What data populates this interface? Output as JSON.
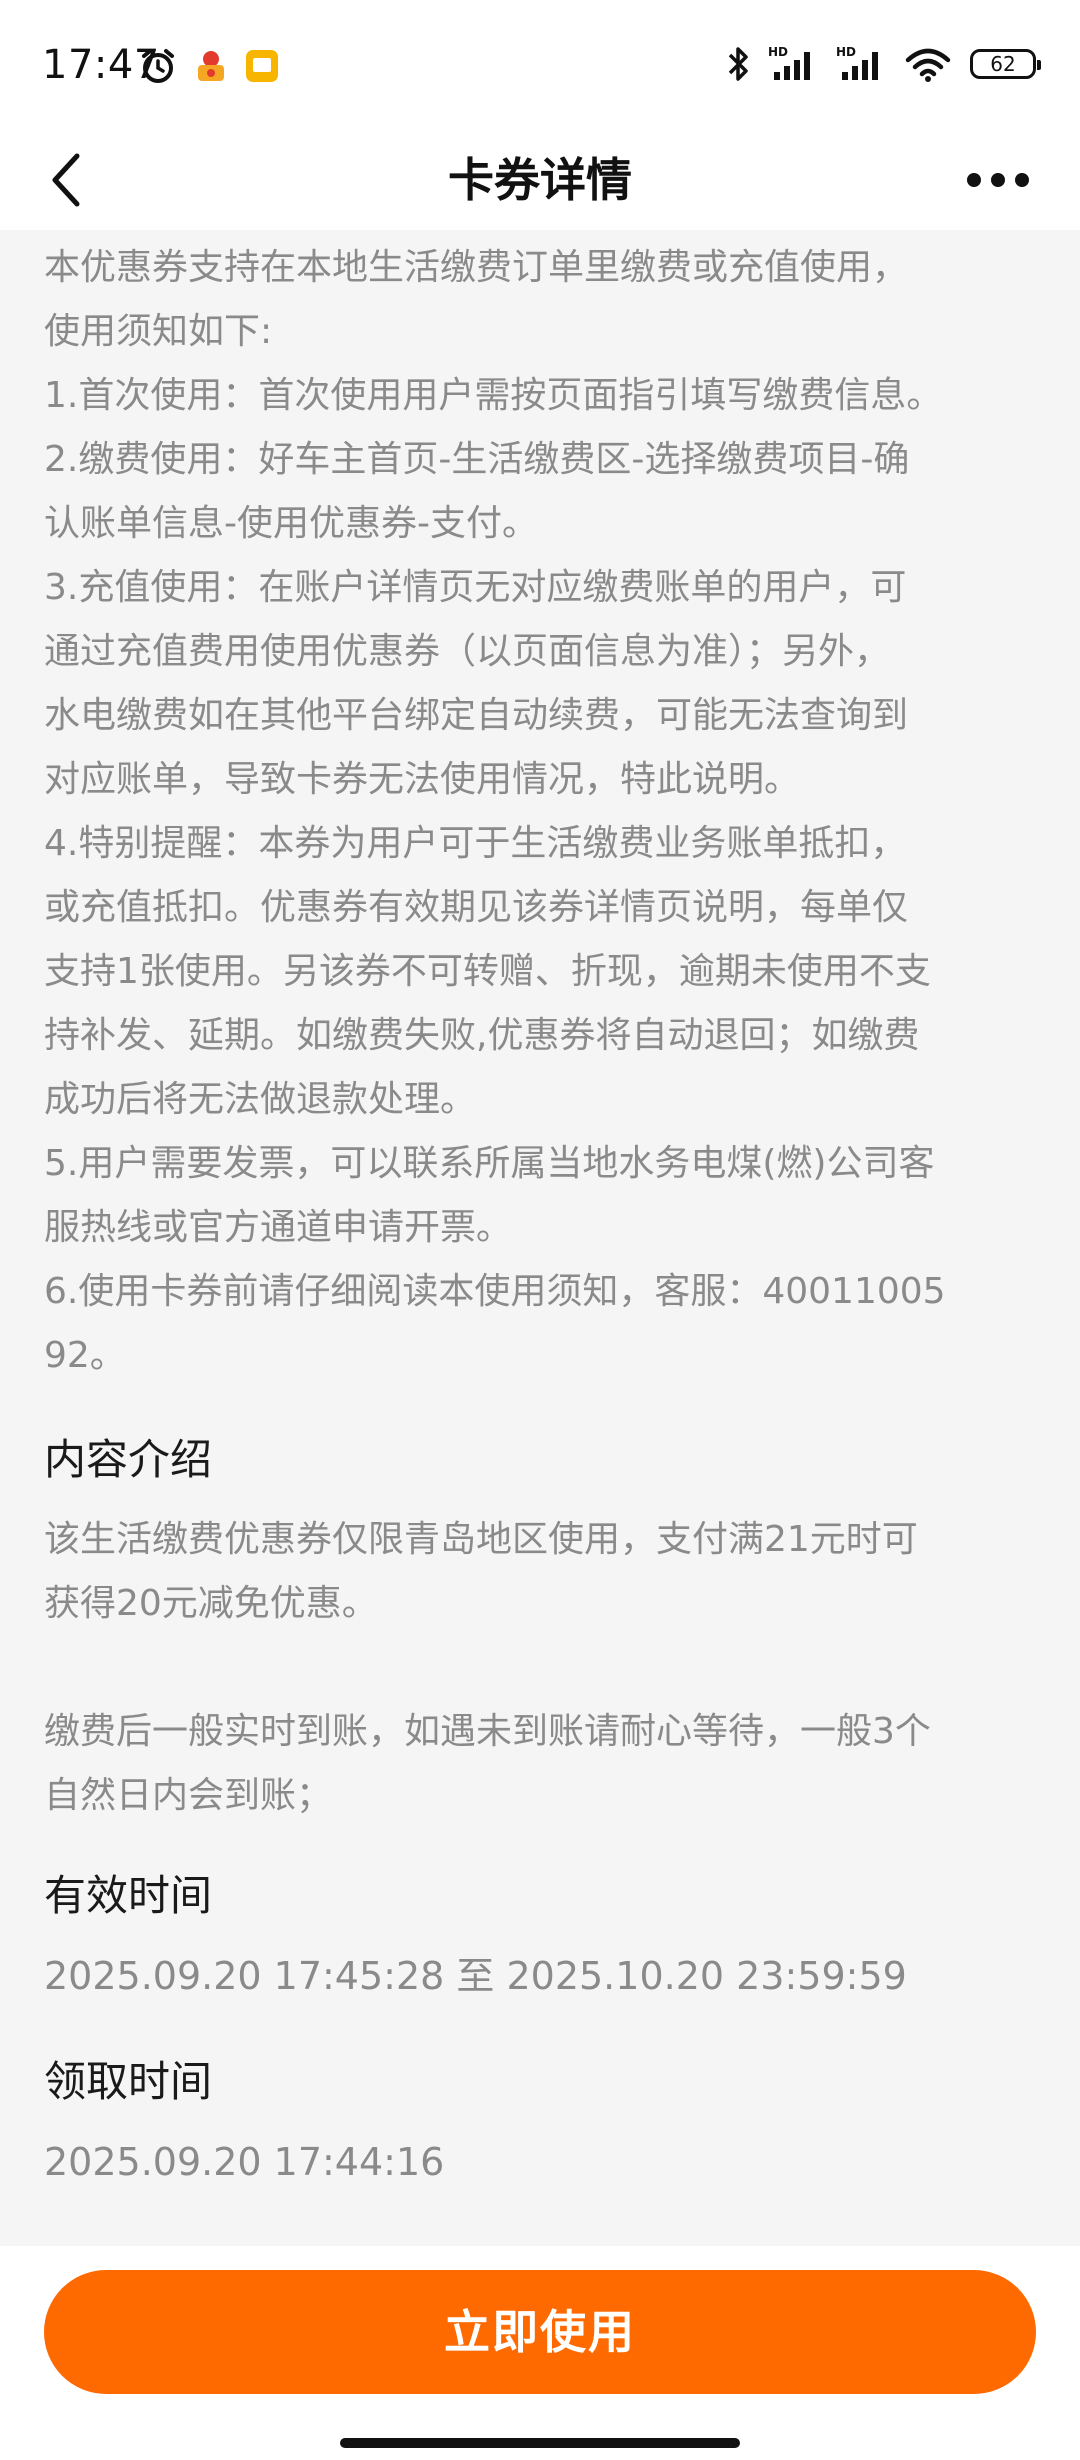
{
  "status": {
    "time": "17:47",
    "battery": "62"
  },
  "nav": {
    "title": "卡券详情"
  },
  "notice_lines": [
    "本优惠券支持在本地生活缴费订单里缴费或充值使用，",
    "使用须知如下:",
    "1.首次使用：首次使用用户需按页面指引填写缴费信息。",
    "2.缴费使用：好车主首页-生活缴费区-选择缴费项目-确",
    "认账单信息-使用优惠券-支付。",
    "3.充值使用：在账户详情页无对应缴费账单的用户，可",
    "通过充值费用使用优惠券（以页面信息为准）；另外，",
    "水电缴费如在其他平台绑定自动续费，可能无法查询到",
    "对应账单，导致卡券无法使用情况，特此说明。",
    "4.特别提醒：本券为用户可于生活缴费业务账单抵扣，",
    "或充值抵扣。优惠券有效期见该券详情页说明，每单仅",
    "支持1张使用。另该券不可转赠、折现，逾期未使用不支",
    "持补发、延期。如缴费失败,优惠券将自动退回；如缴费",
    "成功后将无法做退款处理。",
    "5.用户需要发票，可以联系所属当地水务电煤(燃)公司客",
    "服热线或官方通道申请开票。",
    "6.使用卡券前请仔细阅读本使用须知，客服：40011005",
    "92。"
  ],
  "intro": {
    "title": "内容介绍",
    "lines": [
      "该生活缴费优惠券仅限青岛地区使用，支付满21元时可",
      "获得20元减免优惠。",
      "",
      "缴费后一般实时到账，如遇未到账请耐心等待，一般3个",
      "自然日内会到账；"
    ]
  },
  "validity": {
    "title": "有效时间",
    "value": "2025.09.20 17:45:28 至 2025.10.20 23:59:59"
  },
  "received": {
    "title": "领取时间",
    "value": "2025.09.20 17:44:16"
  },
  "action": {
    "use_label": "立即使用"
  },
  "colors": {
    "accent": "#ff6a00",
    "muted_text": "#8a8a8a",
    "page_bg": "#f5f5f5"
  }
}
